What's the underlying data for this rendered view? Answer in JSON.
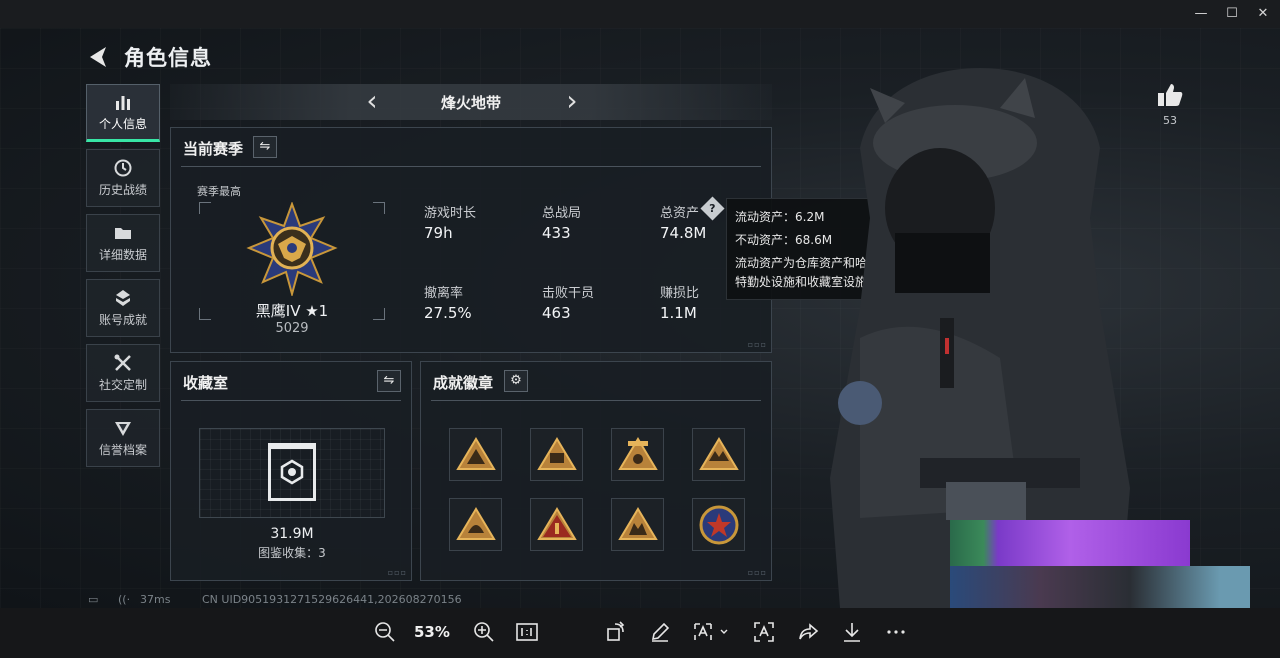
{
  "window": {
    "minimize": "—",
    "maximize": "☐",
    "close": "✕"
  },
  "header": {
    "title": "角色信息"
  },
  "nav": {
    "items": [
      {
        "label": "个人信息",
        "icon": "bar-chart-icon",
        "glyph": "▮▮▮",
        "active": true
      },
      {
        "label": "历史战绩",
        "icon": "clock-icon",
        "glyph": "◷"
      },
      {
        "label": "详细数据",
        "icon": "folder-icon",
        "glyph": "▬"
      },
      {
        "label": "账号成就",
        "icon": "chevron-badge-icon",
        "glyph": "✥"
      },
      {
        "label": "社交定制",
        "icon": "tools-icon",
        "glyph": "✕"
      },
      {
        "label": "信誉档案",
        "icon": "shield-icon",
        "glyph": "▼"
      }
    ]
  },
  "mode": {
    "name": "烽火地带",
    "prev": "‹",
    "next": "›"
  },
  "season": {
    "title": "当前赛季",
    "swap": "⇋",
    "best_label": "赛季最高",
    "rank": "黑鹰IV ★1",
    "score": "5029",
    "stats": [
      {
        "label": "游戏时长",
        "value": "79h"
      },
      {
        "label": "总战局",
        "value": "433"
      },
      {
        "label": "总资产",
        "value": "74.8M",
        "help": "?"
      },
      {
        "label": "撤离率",
        "value": "27.5%"
      },
      {
        "label": "击败干员",
        "value": "463"
      },
      {
        "label": "赚损比",
        "value": "1.1M"
      }
    ],
    "corner": "▫▫▫"
  },
  "tooltip": {
    "line1": "流动资产：6.2M",
    "line2": "不动资产：68.6M",
    "desc": "流动资产为仓库资产和哈夫币，不动资产为特勤处设施和收藏室设施"
  },
  "collection": {
    "title": "收藏室",
    "swap": "⇋",
    "value": "31.9M",
    "count": "图鉴收集：3",
    "corner": "▫▫▫"
  },
  "achievements": {
    "title": "成就徽章",
    "gear": "⚙",
    "corner": "▫▫▫",
    "count": 8
  },
  "profile": {
    "like_icon": "👍",
    "like_count": "53"
  },
  "status": {
    "battery": "▭",
    "wifi": "((·",
    "ping": "37ms",
    "uid": "CN UID9051931271529626441,202608270156"
  },
  "toolbar": {
    "zoom": "53%"
  },
  "colors": {
    "accent": "#38e6a6",
    "gold": "#c8973a",
    "panel": "#181e24"
  }
}
